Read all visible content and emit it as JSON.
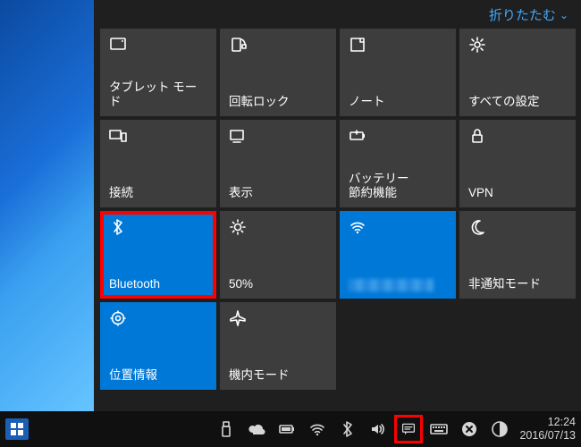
{
  "collapse_label": "折りたたむ",
  "tiles": [
    {
      "id": "tablet-mode",
      "label": "タブレット モード",
      "icon": "tablet-icon",
      "active": false
    },
    {
      "id": "rotation-lock",
      "label": "回転ロック",
      "icon": "rotation-lock-icon",
      "active": false
    },
    {
      "id": "note",
      "label": "ノート",
      "icon": "note-icon",
      "active": false
    },
    {
      "id": "all-settings",
      "label": "すべての設定",
      "icon": "settings-icon",
      "active": false
    },
    {
      "id": "connect",
      "label": "接続",
      "icon": "connect-icon",
      "active": false
    },
    {
      "id": "project",
      "label": "表示",
      "icon": "project-icon",
      "active": false
    },
    {
      "id": "battery-saver",
      "label": "バッテリー\n節約機能",
      "icon": "battery-saver-icon",
      "active": false
    },
    {
      "id": "vpn",
      "label": "VPN",
      "icon": "vpn-icon",
      "active": false
    },
    {
      "id": "bluetooth",
      "label": "Bluetooth",
      "icon": "bluetooth-icon",
      "active": true,
      "highlight": true
    },
    {
      "id": "brightness",
      "label": "50%",
      "icon": "brightness-icon",
      "active": false
    },
    {
      "id": "wifi",
      "label": "",
      "icon": "wifi-icon",
      "active": true,
      "blurred": true
    },
    {
      "id": "quiet-hours",
      "label": "非通知モード",
      "icon": "moon-icon",
      "active": false
    },
    {
      "id": "location",
      "label": "位置情報",
      "icon": "location-icon",
      "active": true
    },
    {
      "id": "airplane",
      "label": "機内モード",
      "icon": "airplane-icon",
      "active": false
    }
  ],
  "tray": {
    "icons": [
      "usb-icon",
      "onedrive-icon",
      "battery-icon",
      "wifi-icon",
      "bluetooth-icon",
      "volume-icon",
      "action-center-icon",
      "keyboard-icon",
      "close-icon",
      "contrast-icon"
    ],
    "highlight_icon": "action-center-icon"
  },
  "clock": {
    "time": "12:24",
    "date": "2016/07/13"
  }
}
